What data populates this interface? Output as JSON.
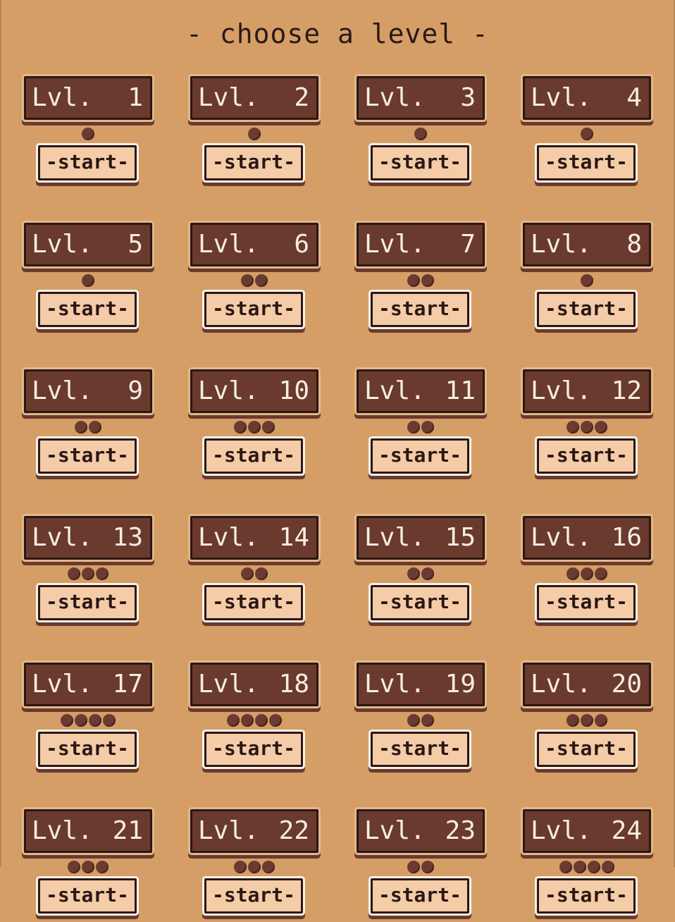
{
  "title": "- choose a level -",
  "level_prefix": "Lvl.",
  "start_label": "-start-",
  "colors": {
    "background": "#d59e66",
    "badge": "#6a3a2e",
    "button": "#f4cca8",
    "dot": "#6b3b32"
  },
  "levels": [
    {
      "number": "1",
      "dots": 1
    },
    {
      "number": "2",
      "dots": 1
    },
    {
      "number": "3",
      "dots": 1
    },
    {
      "number": "4",
      "dots": 1
    },
    {
      "number": "5",
      "dots": 1
    },
    {
      "number": "6",
      "dots": 2
    },
    {
      "number": "7",
      "dots": 2
    },
    {
      "number": "8",
      "dots": 1
    },
    {
      "number": "9",
      "dots": 2
    },
    {
      "number": "10",
      "dots": 3
    },
    {
      "number": "11",
      "dots": 2
    },
    {
      "number": "12",
      "dots": 3
    },
    {
      "number": "13",
      "dots": 3
    },
    {
      "number": "14",
      "dots": 2
    },
    {
      "number": "15",
      "dots": 2
    },
    {
      "number": "16",
      "dots": 3
    },
    {
      "number": "17",
      "dots": 4
    },
    {
      "number": "18",
      "dots": 4
    },
    {
      "number": "19",
      "dots": 2
    },
    {
      "number": "20",
      "dots": 3
    },
    {
      "number": "21",
      "dots": 3
    },
    {
      "number": "22",
      "dots": 3
    },
    {
      "number": "23",
      "dots": 2
    },
    {
      "number": "24",
      "dots": 4
    }
  ]
}
